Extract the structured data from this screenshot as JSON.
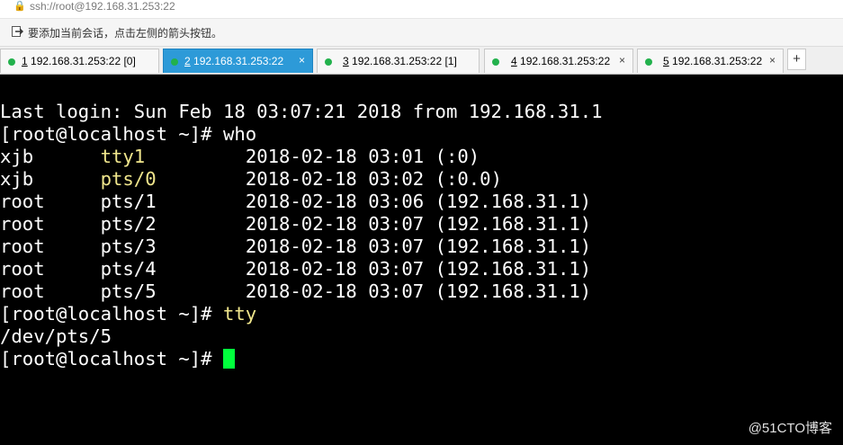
{
  "address_bar": {
    "lock_icon": "lock-icon",
    "text": "ssh://root@192.168.31.253:22"
  },
  "hint_bar": {
    "icon": "arrow-button-icon",
    "text": "要添加当前会话，点击左侧的箭头按钮。"
  },
  "tabs": [
    {
      "num": "1",
      "label": " 192.168.31.253:22 [0]",
      "active": false
    },
    {
      "num": "2",
      "label": " 192.168.31.253:22",
      "active": true
    },
    {
      "num": "3",
      "label": " 192.168.31.253:22 [1]",
      "active": false
    },
    {
      "num": "4",
      "label": " 192.168.31.253:22",
      "active": false
    },
    {
      "num": "5",
      "label": " 192.168.31.253:22",
      "active": false
    }
  ],
  "tab_close": "×",
  "add_tab": "+",
  "terminal": {
    "last_login": "Last login: Sun Feb 18 03:07:21 2018 from 192.168.31.1",
    "prompt": "[root@localhost ~]# ",
    "cmd1": "who",
    "who_rows": [
      {
        "user": "xjb",
        "tty": "tty1",
        "time": "2018-02-18 03:01 (:0)"
      },
      {
        "user": "xjb",
        "tty": "pts/0",
        "time": "2018-02-18 03:02 (:0.0)"
      },
      {
        "user": "root",
        "tty": "pts/1",
        "time": "2018-02-18 03:06 (192.168.31.1)"
      },
      {
        "user": "root",
        "tty": "pts/2",
        "time": "2018-02-18 03:07 (192.168.31.1)"
      },
      {
        "user": "root",
        "tty": "pts/3",
        "time": "2018-02-18 03:07 (192.168.31.1)"
      },
      {
        "user": "root",
        "tty": "pts/4",
        "time": "2018-02-18 03:07 (192.168.31.1)"
      },
      {
        "user": "root",
        "tty": "pts/5",
        "time": "2018-02-18 03:07 (192.168.31.1)"
      }
    ],
    "cmd2": "tty",
    "tty_output": "/dev/pts/5"
  },
  "watermark": "@51CTO博客",
  "colors": {
    "tab_active": "#2d9ad8",
    "status_dot": "#22b14c",
    "cursor": "#00ff3c",
    "tty_text": "#f0e68c"
  }
}
